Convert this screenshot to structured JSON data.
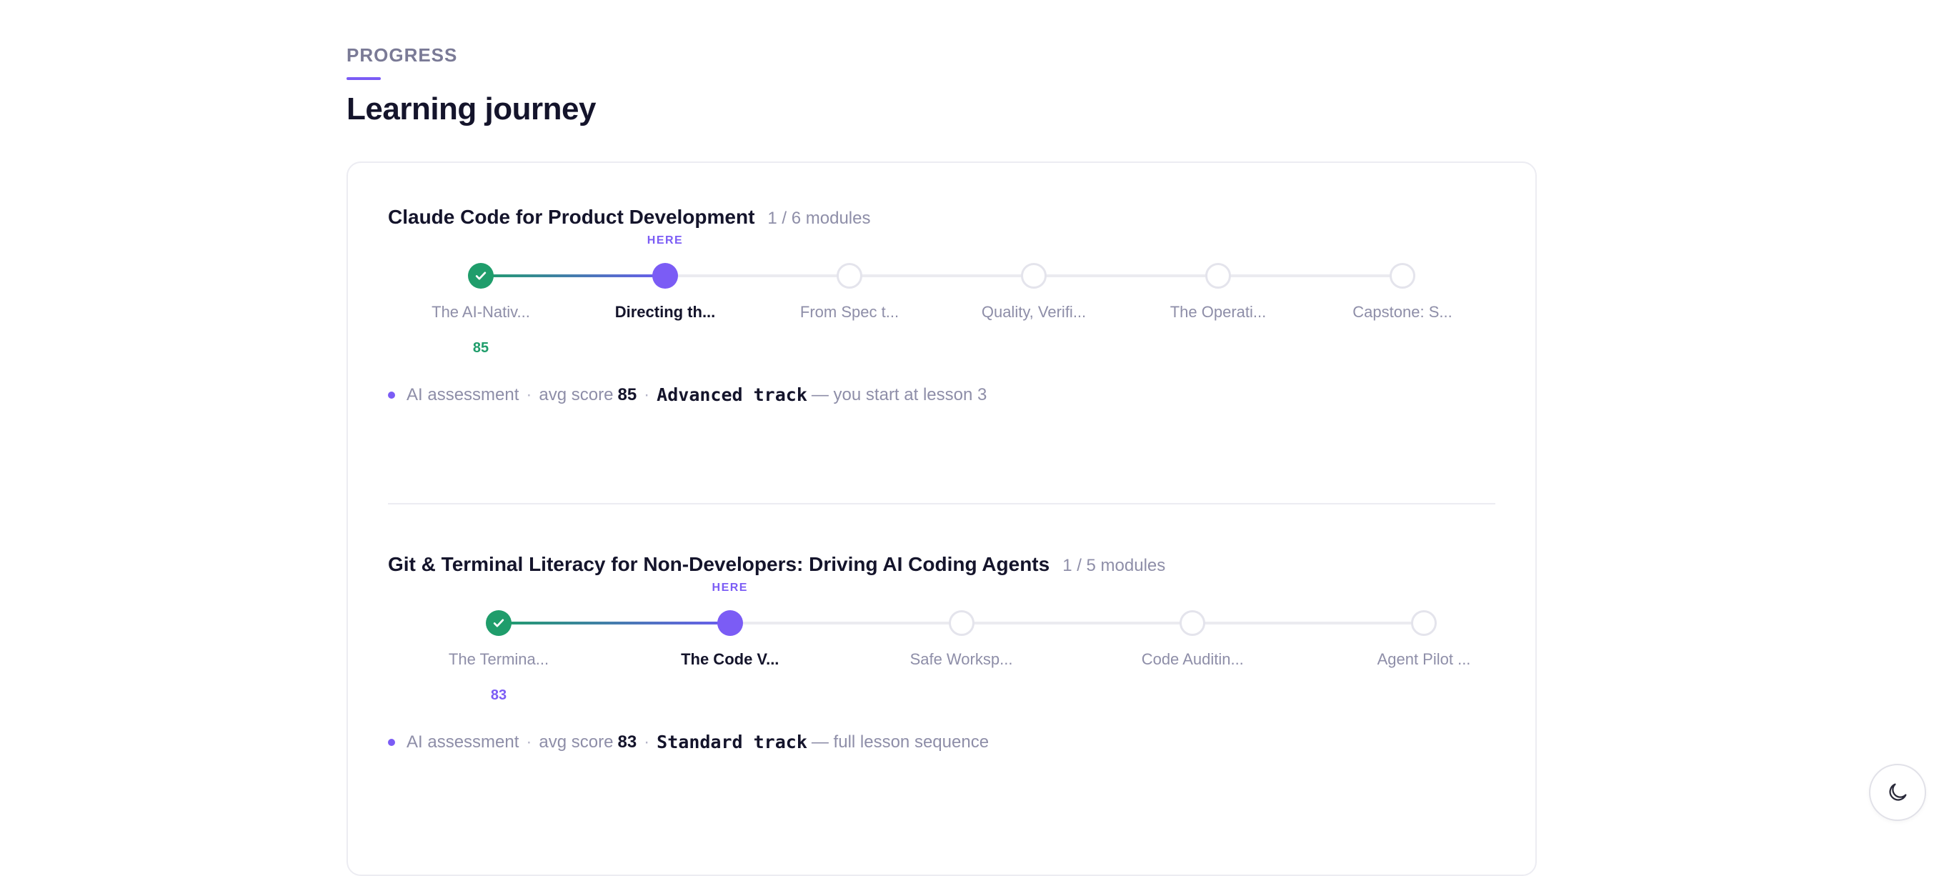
{
  "header": {
    "eyebrow": "PROGRESS",
    "title": "Learning journey"
  },
  "courses": [
    {
      "title": "Claude Code for Product Development",
      "count": "1 / 6 modules",
      "here_label": "HERE",
      "modules": [
        {
          "label": "The AI-Nativ...",
          "status": "done",
          "score": "85",
          "score_color": "#1f9d6b"
        },
        {
          "label": "Directing th...",
          "status": "current"
        },
        {
          "label": "From Spec t...",
          "status": "todo"
        },
        {
          "label": "Quality, Verifi...",
          "status": "todo"
        },
        {
          "label": "The Operati...",
          "status": "todo"
        },
        {
          "label": "Capstone: S...",
          "status": "todo"
        }
      ],
      "assessment": {
        "label": "AI assessment",
        "sep": "·",
        "avg_label": "avg score",
        "avg_score": "85",
        "track": "Advanced track",
        "note": "— you start at lesson 3"
      }
    },
    {
      "title": "Git & Terminal Literacy for Non-Developers: Driving AI Coding Agents",
      "count": "1 / 5 modules",
      "here_label": "HERE",
      "modules": [
        {
          "label": "The Termina...",
          "status": "done",
          "score": "83",
          "score_color": "#7b5cf5"
        },
        {
          "label": "The Code V...",
          "status": "current"
        },
        {
          "label": "Safe Worksp...",
          "status": "todo"
        },
        {
          "label": "Code Auditin...",
          "status": "todo"
        },
        {
          "label": "Agent Pilot ...",
          "status": "todo"
        }
      ],
      "assessment": {
        "label": "AI assessment",
        "sep": "·",
        "avg_label": "avg score",
        "avg_score": "83",
        "track": "Standard track",
        "note": "— full lesson sequence"
      }
    }
  ],
  "theme_toggle": {
    "icon": "moon-icon"
  },
  "colors": {
    "accent": "#7b5cf5",
    "success": "#1f9d6b",
    "muted": "#8e8ea8",
    "ink": "#14142b"
  }
}
